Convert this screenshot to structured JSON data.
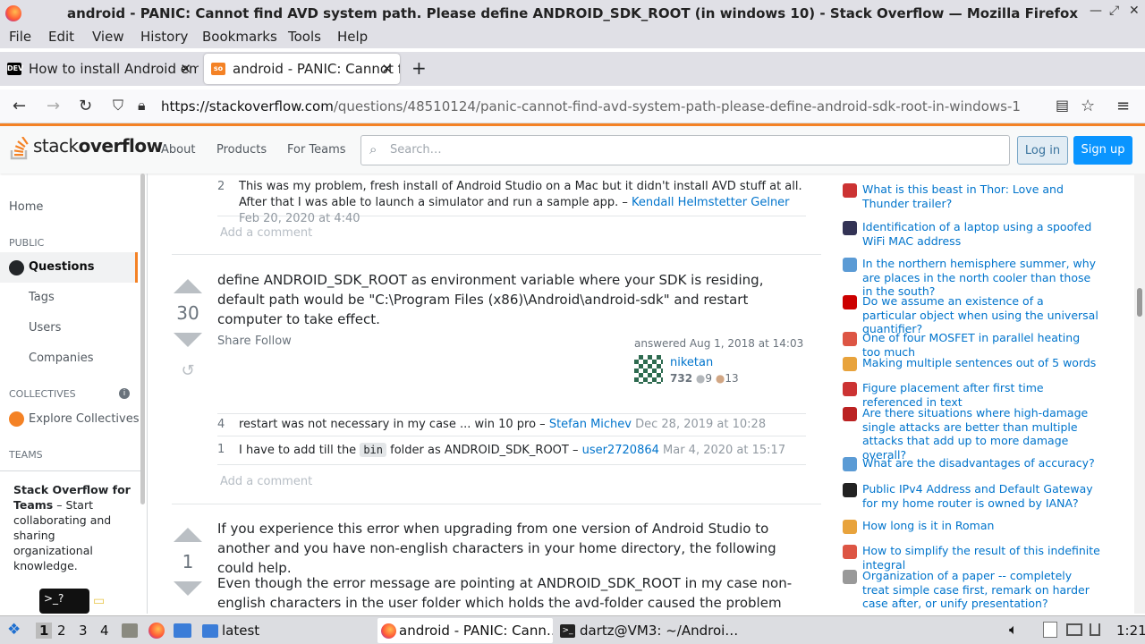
{
  "window": {
    "title": "android - PANIC: Cannot find AVD system path. Please define ANDROID_SDK_ROOT (in windows 10) - Stack Overflow — Mozilla Firefox"
  },
  "menu": [
    "File",
    "Edit",
    "View",
    "History",
    "Bookmarks",
    "Tools",
    "Help"
  ],
  "tabs": [
    {
      "label": "How to install Android em",
      "favicon": "DEV"
    },
    {
      "label": "android - PANIC: Cannot f",
      "favicon": "so"
    }
  ],
  "url": {
    "host": "https://stackoverflow.com",
    "path": "/questions/48510124/panic-cannot-find-avd-system-path-please-define-android-sdk-root-in-windows-1"
  },
  "so": {
    "logo_a": "stack",
    "logo_b": "overflow",
    "links": [
      "About",
      "Products",
      "For Teams"
    ],
    "search_placeholder": "Search…",
    "login": "Log in",
    "signup": "Sign up"
  },
  "leftnav": {
    "home": "Home",
    "public": "PUBLIC",
    "questions": "Questions",
    "tags": "Tags",
    "users": "Users",
    "companies": "Companies",
    "collectives": "COLLECTIVES",
    "explore": "Explore Collectives",
    "teams": "TEAMS",
    "teams_title": "Stack Overflow for Teams",
    "teams_text": " – Start collaborating and sharing organizational knowledge."
  },
  "comments_top": [
    {
      "score": "2",
      "text": "This was my problem, fresh install of Android Studio on a Mac but it didn't install AVD stuff at all. After that I was able to launch a simulator and run a sample app. – ",
      "user": "Kendall Helmstetter Gelner",
      "date": " Feb 20, 2020 at 4:40"
    }
  ],
  "add_comment": "Add a comment",
  "answer1": {
    "votes": "30",
    "body": "define ANDROID_SDK_ROOT as environment variable where your SDK is residing, default path would be \"C:\\Program Files (x86)\\Android\\android-sdk\" and restart computer to take effect.",
    "share": "Share",
    "follow": "Follow",
    "answered": "answered Aug 1, 2018 at 14:03",
    "user": "niketan",
    "rep": "732",
    "silver": "9",
    "bronze": "13",
    "comments": [
      {
        "score": "4",
        "text": "restart was not necessary in my case ... win 10 pro – ",
        "user": "Stefan Michev",
        "date": " Dec 28, 2019 at 10:28"
      },
      {
        "score": "1",
        "pre": "I have to add till the ",
        "code": "bin",
        "post": " folder as ANDROID_SDK_ROOT – ",
        "user": "user2720864",
        "date": " Mar 4, 2020 at 15:17"
      }
    ]
  },
  "answer2": {
    "votes": "1",
    "p1": "If you experience this error when upgrading from one version of Android Studio to another and you have non-english characters in your home directory, the following could help.",
    "p2": "Even though the error message are pointing at ANDROID_SDK_ROOT in my case non-english characters in the user folder which holds the avd-folder caused the problem (C:\\Users\\Björn"
  },
  "hot": [
    {
      "text": "What is this beast in Thor: Love and Thunder trailer?",
      "color": "#c33"
    },
    {
      "text": "Identification of a laptop using a spoofed WiFi MAC address",
      "color": "#335"
    },
    {
      "text": "In the northern hemisphere summer, why are places in the north cooler than those in the south?",
      "color": "#5b9bd5"
    },
    {
      "text": "Do we assume an existence of a particular object when using the universal quantifier?",
      "color": "#c00"
    },
    {
      "text": "One of four MOSFET in parallel heating too much",
      "color": "#d54"
    },
    {
      "text": "Making multiple sentences out of 5 words",
      "color": "#e8a33c"
    },
    {
      "text": "Figure placement after first time referenced in text",
      "color": "#c33"
    },
    {
      "text": "Are there situations where high-damage single attacks are better than multiple attacks that add up to more damage overall?",
      "color": "#b22"
    },
    {
      "text": "What are the disadvantages of accuracy?",
      "color": "#5b9bd5"
    },
    {
      "text": "Public IPv4 Address and Default Gateway for my home router is owned by IANA?",
      "color": "#222"
    },
    {
      "text": "How long is it in Roman",
      "color": "#e8a33c"
    },
    {
      "text": "How to simplify the result of this indefinite integral",
      "color": "#d54"
    },
    {
      "text": "Organization of a paper -- completely treat simple case first, remark on harder case after, or unify presentation?",
      "color": "#999"
    }
  ],
  "taskbar": {
    "workspaces": [
      "1",
      "2",
      "3",
      "4"
    ],
    "folder": "latest",
    "firefox": "android - PANIC: Cann…",
    "terminal": "dartz@VM3: ~/Androi…",
    "clock": "1:21"
  }
}
